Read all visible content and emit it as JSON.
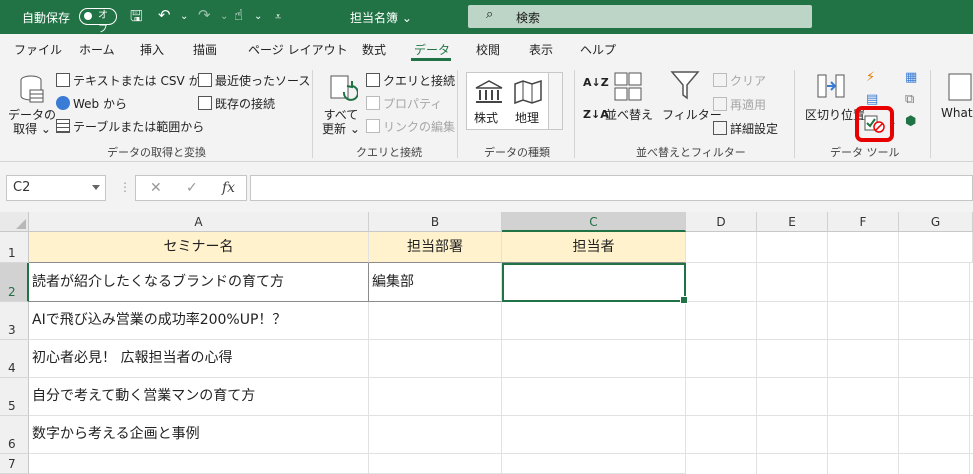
{
  "titlebar": {
    "autosave_label": "自動保存",
    "autosave_state": "オフ",
    "doc_title": "担当名簿 ⌄",
    "search_placeholder": "検索"
  },
  "tabs": [
    {
      "label": "ファイル"
    },
    {
      "label": "ホーム"
    },
    {
      "label": "挿入"
    },
    {
      "label": "描画"
    },
    {
      "label": "ページ レイアウト"
    },
    {
      "label": "数式"
    },
    {
      "label": "データ"
    },
    {
      "label": "校閲"
    },
    {
      "label": "表示"
    },
    {
      "label": "ヘルプ"
    }
  ],
  "ribbon": {
    "get_data": "データの\n取得 ⌄",
    "text_csv": "テキストまたは CSV から",
    "web": "Web から",
    "table_range": "テーブルまたは範囲から",
    "recent_sources": "最近使ったソース",
    "existing_conn": "既存の接続",
    "group_get": "データの取得と変換",
    "refresh_all": "すべて\n更新 ⌄",
    "queries_conn": "クエリと接続",
    "properties": "プロパティ",
    "edit_links": "リンクの編集",
    "group_queries": "クエリと接続",
    "stocks": "株式",
    "geography": "地理",
    "group_types": "データの種類",
    "sort": "並べ替え",
    "filter": "フィルター",
    "clear": "クリア",
    "reapply": "再適用",
    "advanced": "詳細設定",
    "group_sort": "並べ替えとフィルター",
    "text_to_columns": "区切り位置",
    "group_tools": "データ ツール",
    "whatif": "What-"
  },
  "formula_bar": {
    "name_box": "C2",
    "cancel": "✕",
    "enter": "✓",
    "fx": "fx",
    "formula": ""
  },
  "grid": {
    "columns": [
      "A",
      "B",
      "C",
      "D",
      "E",
      "F",
      "G"
    ],
    "rows": [
      "1",
      "2",
      "3",
      "4",
      "5",
      "6",
      "7"
    ],
    "header": [
      "セミナー名",
      "担当部署",
      "担当者"
    ],
    "data": [
      [
        "読者が紹介したくなるブランドの育て方",
        "編集部",
        ""
      ],
      [
        "AIで飛び込み営業の成功率200%UP！？",
        "",
        ""
      ],
      [
        "初心者必見！ 広報担当者の心得",
        "",
        ""
      ],
      [
        "自分で考えて動く営業マンの育て方",
        "",
        ""
      ],
      [
        "数字から考える企画と事例",
        "",
        ""
      ]
    ]
  }
}
